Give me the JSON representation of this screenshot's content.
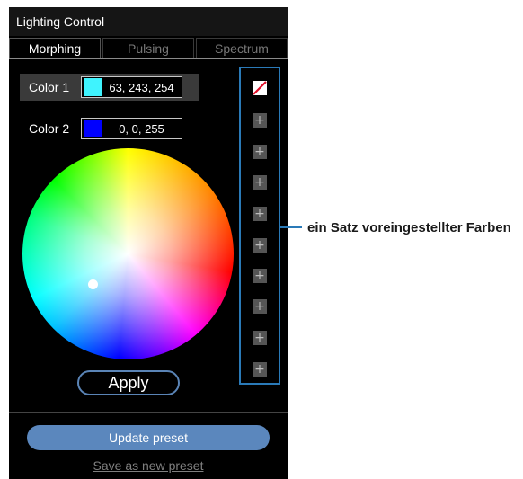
{
  "window": {
    "title": "Lighting Control"
  },
  "tabs": [
    {
      "label": "Morphing",
      "active": true
    },
    {
      "label": "Pulsing",
      "active": false
    },
    {
      "label": "Spectrum",
      "active": false
    }
  ],
  "color1": {
    "label": "Color 1",
    "value": "63, 243, 254",
    "swatch": "#3ff3fe"
  },
  "color2": {
    "label": "Color 2",
    "value": "0, 0, 255",
    "swatch": "#0000ff"
  },
  "apply_label": "Apply",
  "update_preset_label": "Update preset",
  "save_new_preset_label": "Save as new preset",
  "preset_slots": {
    "first": "none-icon",
    "empty_slot_icon": "plus-icon",
    "empty_glyph": "+"
  },
  "callout": {
    "text": "ein Satz voreingestellter Farben"
  },
  "colors": {
    "accent": "#2a7ab8",
    "button": "#5b87bd"
  }
}
